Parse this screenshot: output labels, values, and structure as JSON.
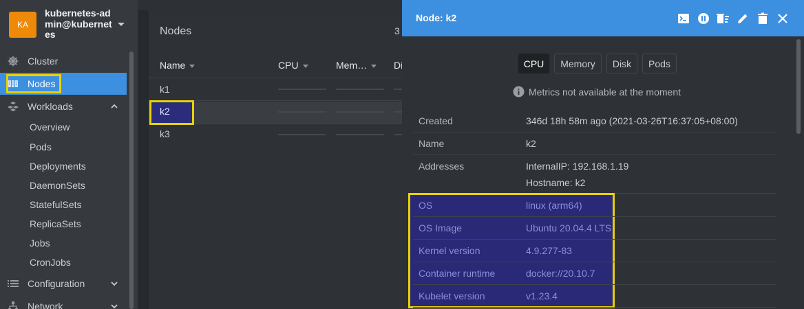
{
  "user": {
    "initials": "KA",
    "name": "kubernetes-admin@kubernetes"
  },
  "sidebar": {
    "items": [
      {
        "label": "Cluster",
        "icon": "helm-wheel-icon"
      },
      {
        "label": "Nodes",
        "icon": "nodes-icon"
      },
      {
        "label": "Workloads",
        "icon": "workloads-icon"
      },
      {
        "label": "Configuration",
        "icon": "list-icon"
      },
      {
        "label": "Network",
        "icon": "network-icon"
      }
    ],
    "workloads_sub": [
      "Overview",
      "Pods",
      "Deployments",
      "DaemonSets",
      "StatefulSets",
      "ReplicaSets",
      "Jobs",
      "CronJobs"
    ]
  },
  "nodes_table": {
    "title": "Nodes",
    "count": "3",
    "columns": [
      "Name",
      "CPU",
      "Mem…",
      "Di"
    ],
    "rows": [
      "k1",
      "k2",
      "k3"
    ],
    "selected": "k2"
  },
  "panel": {
    "title": "Node: k2",
    "tabs": [
      "CPU",
      "Memory",
      "Disk",
      "Pods"
    ],
    "active_tab": "CPU",
    "metrics_notice": "Metrics not available at the moment",
    "details": [
      {
        "label": "Created",
        "value": "346d 18h 58m ago (2021-03-26T16:37:05+08:00)"
      },
      {
        "label": "Name",
        "value": "k2"
      },
      {
        "label": "Addresses",
        "value": "InternalIP: 192.168.1.19",
        "value2": "Hostname: k2"
      },
      {
        "label": "OS",
        "value": "linux (arm64)"
      },
      {
        "label": "OS Image",
        "value": "Ubuntu 20.04.4 LTS"
      },
      {
        "label": "Kernel version",
        "value": "4.9.277-83"
      },
      {
        "label": "Container runtime",
        "value": "docker://20.10.7"
      },
      {
        "label": "Kubelet version",
        "value": "v1.23.4"
      }
    ]
  },
  "colors": {
    "accent": "#3d8fe0",
    "highlight": "#e8d200",
    "avatar": "#ee8a0a"
  }
}
